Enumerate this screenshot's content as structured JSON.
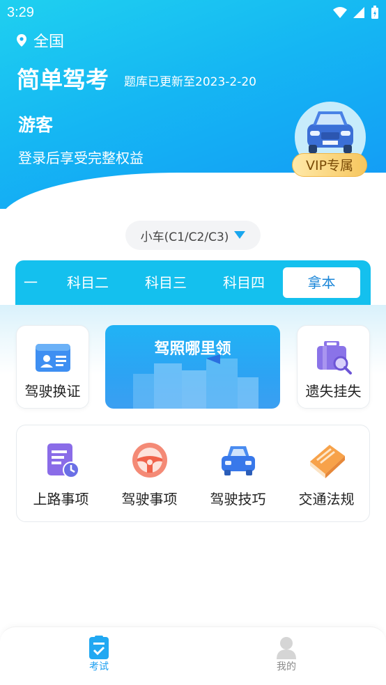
{
  "status": {
    "time": "3:29"
  },
  "location": {
    "label": "全国"
  },
  "header": {
    "title": "简单驾考",
    "update_note": "题库已更新至2023-2-20",
    "user_name": "游客",
    "user_hint": "登录后享受完整权益",
    "vip_label": "VIP专属"
  },
  "car_type": {
    "label": "小车(C1/C2/C3)"
  },
  "tabs": [
    {
      "label": "一",
      "active": false
    },
    {
      "label": "科目二",
      "active": false
    },
    {
      "label": "科目三",
      "active": false
    },
    {
      "label": "科目四",
      "active": false
    },
    {
      "label": "拿本",
      "active": true
    }
  ],
  "services": {
    "left": {
      "label": "驾驶换证",
      "icon": "license-card-icon"
    },
    "banner": {
      "title": "驾照哪里领"
    },
    "right": {
      "label": "遗失挂失",
      "icon": "lost-search-icon"
    }
  },
  "guides": [
    {
      "label": "上路事项",
      "icon": "calendar-clock-icon"
    },
    {
      "label": "驾驶事项",
      "icon": "steering-wheel-icon"
    },
    {
      "label": "驾驶技巧",
      "icon": "car-icon"
    },
    {
      "label": "交通法规",
      "icon": "book-icon"
    }
  ],
  "bottom_nav": [
    {
      "label": "考试",
      "active": true,
      "icon": "exam-icon"
    },
    {
      "label": "我的",
      "active": false,
      "icon": "profile-icon"
    }
  ],
  "colors": {
    "brand": "#15b6f3",
    "tab_active_text": "#1a86d8",
    "vip_gold": "#f6c65e"
  }
}
